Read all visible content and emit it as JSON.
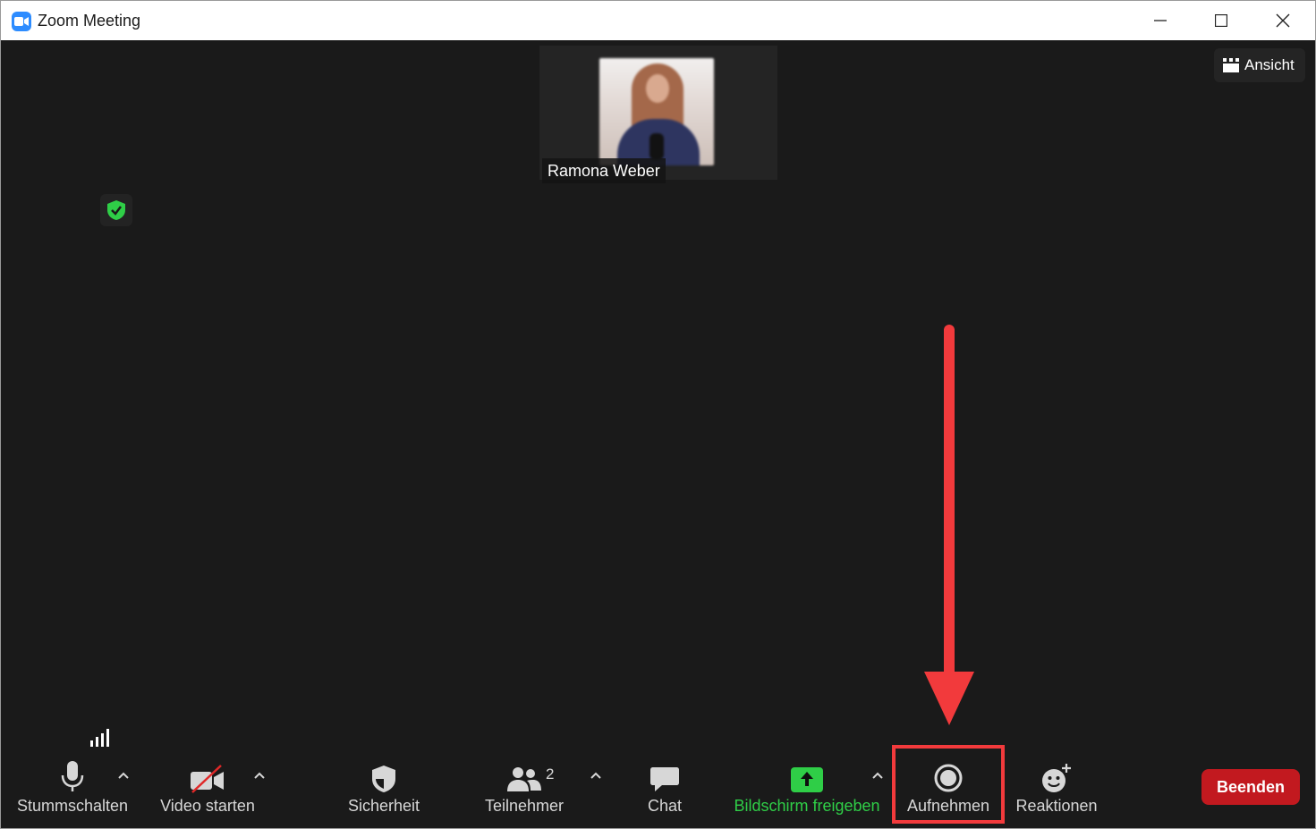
{
  "window": {
    "title": "Zoom Meeting",
    "controls": [
      "minimize-icon",
      "maximize-icon",
      "close-icon"
    ]
  },
  "meeting": {
    "participant_name": "Ramona Weber",
    "view_button_label": "Ansicht"
  },
  "toolbar": {
    "mute_label": "Stummschalten",
    "video_label": "Video starten",
    "security_label": "Sicherheit",
    "participants_label": "Teilnehmer",
    "participants_count": "2",
    "chat_label": "Chat",
    "share_label": "Bildschirm freigeben",
    "record_label": "Aufnehmen",
    "reactions_label": "Reaktionen",
    "end_label": "Beenden"
  },
  "colors": {
    "accent_blue": "#2d8cff",
    "share_green": "#2fce47",
    "end_red": "#c2191f",
    "annotation_red": "#f23a3c",
    "background": "#1a1a1a"
  }
}
